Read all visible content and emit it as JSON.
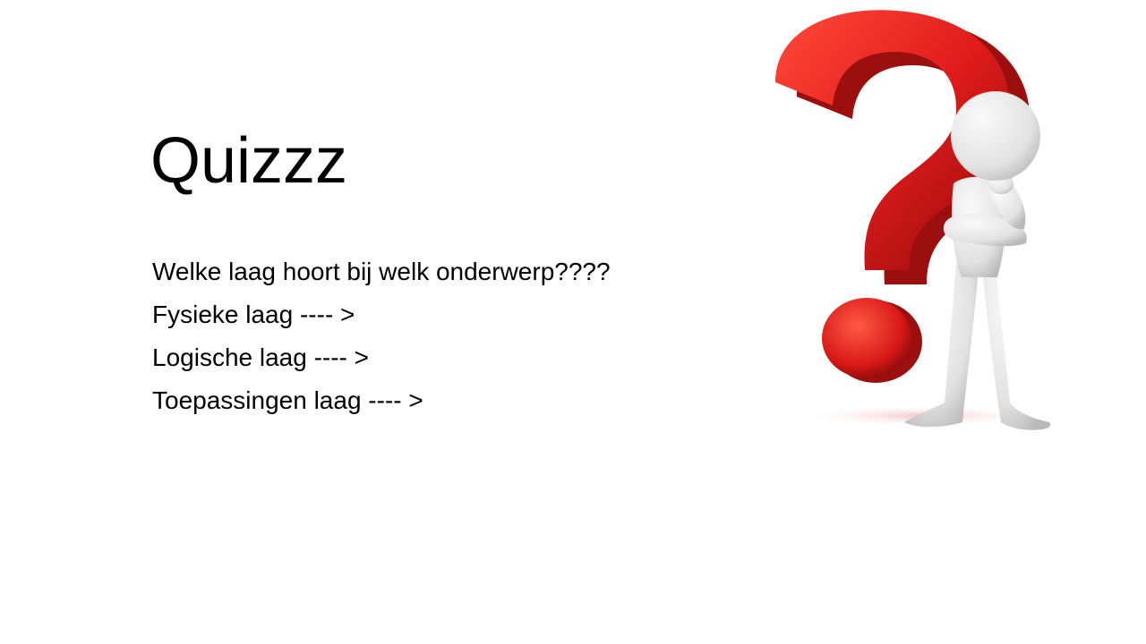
{
  "slide": {
    "title": "Quizzz",
    "lines": [
      "Welke laag hoort bij welk onderwerp????",
      "Fysieke laag ---- >",
      "Logische laag ---- >",
      "Toepassingen laag ---- >"
    ]
  },
  "illustration": {
    "icon": "question-mark-thinking-figure-icon",
    "colors": {
      "question_mark": "#e01b1b",
      "figure": "#e6e6e6"
    }
  }
}
